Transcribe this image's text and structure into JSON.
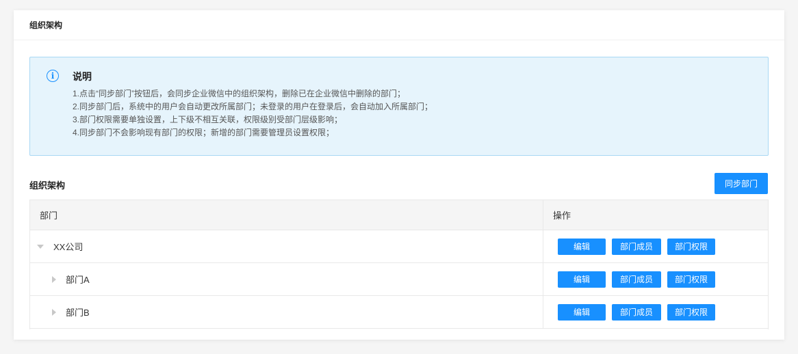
{
  "header": {
    "title": "组织架构"
  },
  "notice": {
    "icon": "info-icon",
    "title": "说明",
    "lines": [
      "1.点击“同步部门”按钮后，会同步企业微信中的组织架构，删除已在企业微信中删除的部门；",
      "2.同步部门后，系统中的用户会自动更改所属部门；未登录的用户在登录后，会自动加入所属部门；",
      "3.部门权限需要单独设置，上下级不相互关联，权限级别受部门层级影响；",
      "4.同步部门不会影响现有部门的权限；新增的部门需要管理员设置权限；"
    ]
  },
  "section": {
    "title": "组织架构",
    "sync_label": "同步部门"
  },
  "table": {
    "columns": [
      "部门",
      "操作"
    ],
    "rows": [
      {
        "name": "XX公司",
        "expanded": true
      },
      {
        "name": "部门A",
        "expanded": false
      },
      {
        "name": "部门B",
        "expanded": false
      }
    ],
    "actions": {
      "edit": "编辑",
      "members": "部门成员",
      "permissions": "部门权限"
    }
  },
  "colors": {
    "accent": "#1890ff",
    "notice_bg": "#e6f4fc",
    "notice_border": "#a8d8f4"
  }
}
